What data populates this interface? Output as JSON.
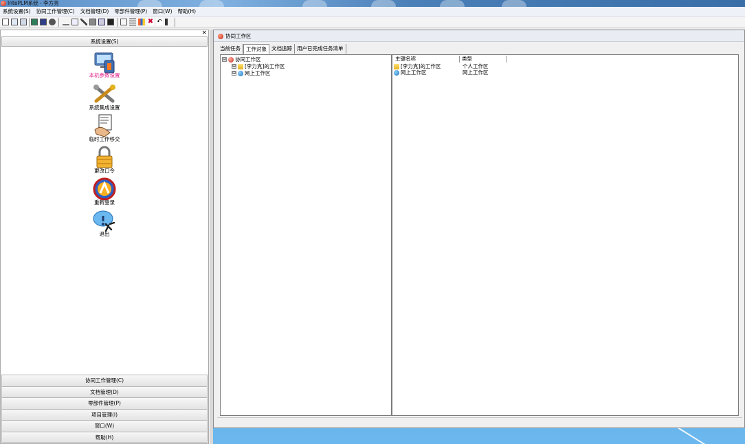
{
  "window": {
    "title": "IntePLM系统 - 李方亮"
  },
  "menubar": {
    "items": [
      {
        "label": "系统设置(S)"
      },
      {
        "label": "协同工作管理(C)"
      },
      {
        "label": "文档管理(D)"
      },
      {
        "label": "零部件管理(P)"
      },
      {
        "label": "窗口(W)"
      },
      {
        "label": "帮助(H)"
      }
    ]
  },
  "toolbar": {
    "icons": [
      "new-icon",
      "open-icon",
      "save-icon",
      "view-icon",
      "window-icon",
      "refresh-icon",
      "search-icon",
      "edit-icon",
      "sign-icon",
      "print-icon",
      "users-icon",
      "settings-icon",
      "list-icon",
      "tree-icon",
      "chart-icon",
      "delete-icon",
      "undo-icon",
      "exit-icon"
    ]
  },
  "leftpanel": {
    "close": "×",
    "header": "系统设置(S)",
    "items": [
      {
        "label": "本机参数设置",
        "icon": "computer-settings-icon"
      },
      {
        "label": "系统集成设置",
        "icon": "tools-icon"
      },
      {
        "label": "临时工作移交",
        "icon": "handover-icon"
      },
      {
        "label": "更改口令",
        "icon": "lock-icon"
      },
      {
        "label": "重新登录",
        "icon": "relogin-icon"
      },
      {
        "label": "退出",
        "icon": "exit-icon"
      }
    ],
    "groups": [
      "协同工作管理(C)",
      "文档管理(D)",
      "零部件管理(P)",
      "项目管理(I)",
      "窗口(W)",
      "帮助(H)"
    ]
  },
  "childwindow": {
    "title": "协同工作区",
    "tabs": [
      {
        "label": "当前任务"
      },
      {
        "label": "工作对象"
      },
      {
        "label": "文档追踪"
      },
      {
        "label": "用户已完成任务清单"
      }
    ],
    "tree": {
      "root": {
        "label": "协同工作区",
        "toggle": "⊟"
      },
      "children": [
        {
          "label": "[李力克]的工作区",
          "toggle": "⊞"
        },
        {
          "label": "网上工作区",
          "toggle": "⊞"
        }
      ]
    },
    "list": {
      "columns": [
        "主键名称",
        "类型"
      ],
      "rows": [
        {
          "name": "[李力克]的工作区",
          "type": "个人工作区"
        },
        {
          "name": "网上工作区",
          "type": "网上工作区"
        }
      ]
    }
  },
  "colors": {
    "accent": "#3a8ed6",
    "highlight_text": "#e0208a"
  }
}
